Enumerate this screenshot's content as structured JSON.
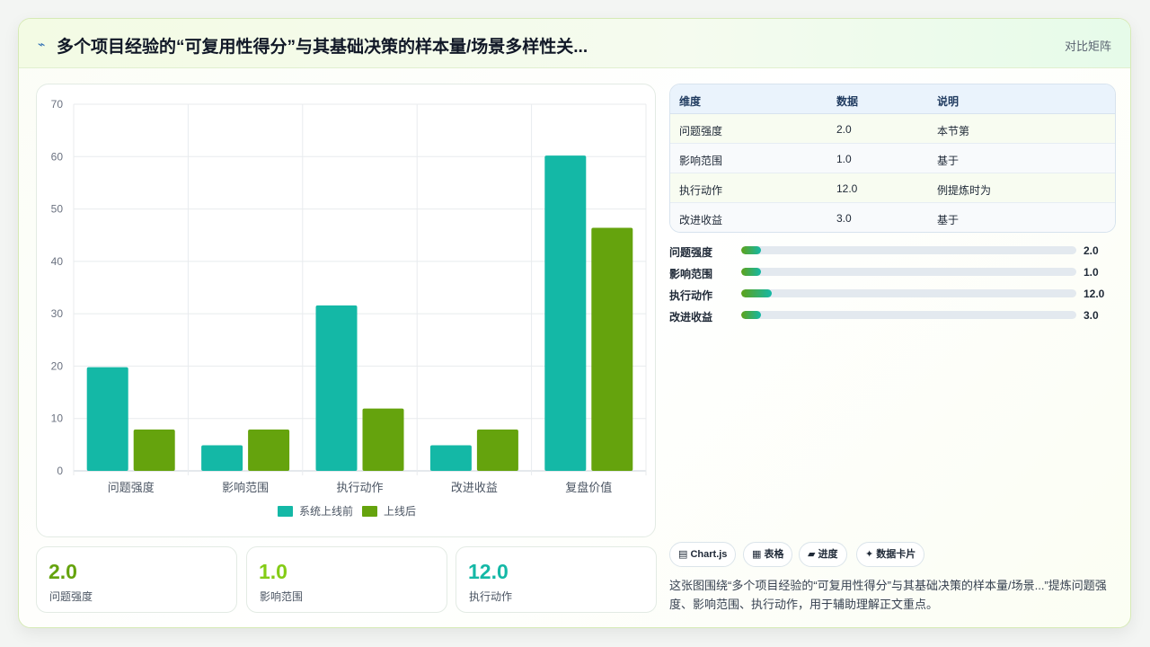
{
  "header": {
    "title": "多个项目经验的“可复用性得分”与其基础决策的样本量/场景多样性关...",
    "link": "对比矩阵",
    "icon": "lightning-icon"
  },
  "chart_data": {
    "type": "bar",
    "categories": [
      "问题强度",
      "影响范围",
      "执行动作",
      "改进收益",
      "复盘价值"
    ],
    "series": [
      {
        "name": "系统上线前",
        "values": [
          19.8,
          4.9,
          31.6,
          4.9,
          60.2
        ],
        "color": "#14b8a6"
      },
      {
        "name": "上线后",
        "values": [
          7.9,
          7.9,
          11.9,
          7.9,
          46.4
        ],
        "color": "#65a30d"
      }
    ],
    "ylim": [
      0,
      70
    ],
    "yticks": [
      "0",
      "10",
      "20",
      "30",
      "40",
      "50",
      "60",
      "70"
    ],
    "grid": true,
    "legend": "bottom"
  },
  "table": {
    "headers": [
      "维度",
      "数据",
      "说明"
    ],
    "rows": [
      [
        "问题强度",
        "2.0",
        "本节第"
      ],
      [
        "影响范围",
        "1.0",
        "基于"
      ],
      [
        "执行动作",
        "12.0",
        "例提炼时为"
      ],
      [
        "改进收益",
        "3.0",
        "基于"
      ]
    ]
  },
  "progress": [
    {
      "label": "问题强度",
      "value": "2.0",
      "fraction": 0.06
    },
    {
      "label": "影响范围",
      "value": "1.0",
      "fraction": 0.06
    },
    {
      "label": "执行动作",
      "value": "12.0",
      "fraction": 0.09
    },
    {
      "label": "改进收益",
      "value": "3.0",
      "fraction": 0.06
    }
  ],
  "stats": [
    {
      "value": "2.0",
      "label": "问题强度",
      "color": "#65a30d"
    },
    {
      "value": "1.0",
      "label": "影响范围",
      "color": "#84cc16"
    },
    {
      "value": "12.0",
      "label": "执行动作",
      "color": "#14b8a6"
    }
  ],
  "tags": [
    {
      "icon": "chart-icon",
      "glyph": "▤",
      "label": "Chart.js"
    },
    {
      "icon": "table-icon",
      "glyph": "▦",
      "label": "表格"
    },
    {
      "icon": "progress-icon",
      "glyph": "▰",
      "label": "进度"
    },
    {
      "icon": "sparkle-icon",
      "glyph": "✦",
      "label": "数据卡片"
    }
  ],
  "description": "这张图围绕“多个项目经验的“可复用性得分”与其基础决策的样本量/场景...”提炼问题强度、影响范围、执行动作，用于辅助理解正文重点。"
}
